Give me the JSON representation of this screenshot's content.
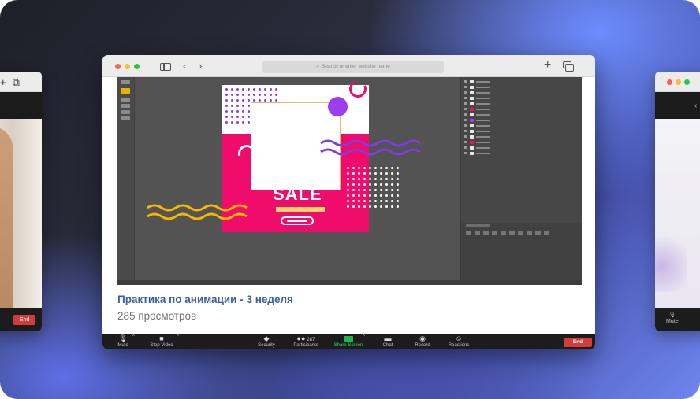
{
  "window": {
    "address_placeholder": "Search or enter website name",
    "new_tab_label": "+"
  },
  "video": {
    "title": "Практика по анимации - 3 неделя",
    "views": "285 просмотров"
  },
  "artboard": {
    "sale_text": "SALE",
    "colors": {
      "pink": "#ef0c6a",
      "purple": "#9b3ef0",
      "yellow": "#f8d26c"
    }
  },
  "controls": {
    "mute": "Mute",
    "stop_video": "Stop Video",
    "security": "Security",
    "participants": "Participants",
    "participants_count": "287",
    "share_screen": "Share Screen",
    "chat": "Chat",
    "record": "Record",
    "reactions": "Reactions",
    "end": "End"
  },
  "side_left": {
    "end": "End"
  },
  "side_right": {
    "mute": "Mute"
  },
  "icons": {
    "mute": "microphone-icon",
    "stop_video": "video-camera-icon",
    "security": "shield-icon",
    "participants": "people-icon",
    "share_screen": "share-arrow-icon",
    "chat": "chat-bubble-icon",
    "record": "record-icon",
    "reactions": "smiley-icon"
  }
}
